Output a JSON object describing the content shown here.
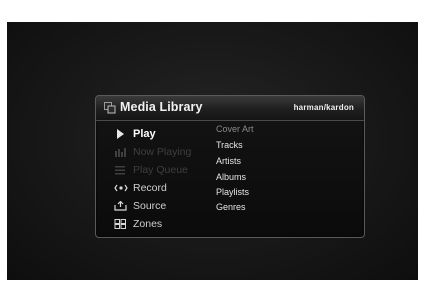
{
  "panel": {
    "title": "Media Library",
    "brand": "harman/kardon"
  },
  "menu": {
    "items": [
      {
        "label": "Play",
        "icon": "play-icon",
        "state": "selected"
      },
      {
        "label": "Now Playing",
        "icon": "now-playing-icon",
        "state": "disabled"
      },
      {
        "label": "Play Queue",
        "icon": "queue-icon",
        "state": "disabled"
      },
      {
        "label": "Record",
        "icon": "record-icon",
        "state": "normal"
      },
      {
        "label": "Source",
        "icon": "source-icon",
        "state": "normal"
      },
      {
        "label": "Zones",
        "icon": "zones-icon",
        "state": "normal"
      }
    ]
  },
  "submenu": {
    "items": [
      {
        "label": "Cover Art",
        "state": "dim"
      },
      {
        "label": "Tracks",
        "state": "normal"
      },
      {
        "label": "Artists",
        "state": "normal"
      },
      {
        "label": "Albums",
        "state": "normal"
      },
      {
        "label": "Playlists",
        "state": "normal"
      },
      {
        "label": "Genres",
        "state": "normal"
      }
    ]
  },
  "colors": {
    "background": "#1a1a1a",
    "panel": "#0f0f0f",
    "text": "#e6e6e6",
    "disabled": "#3f3f3f"
  }
}
